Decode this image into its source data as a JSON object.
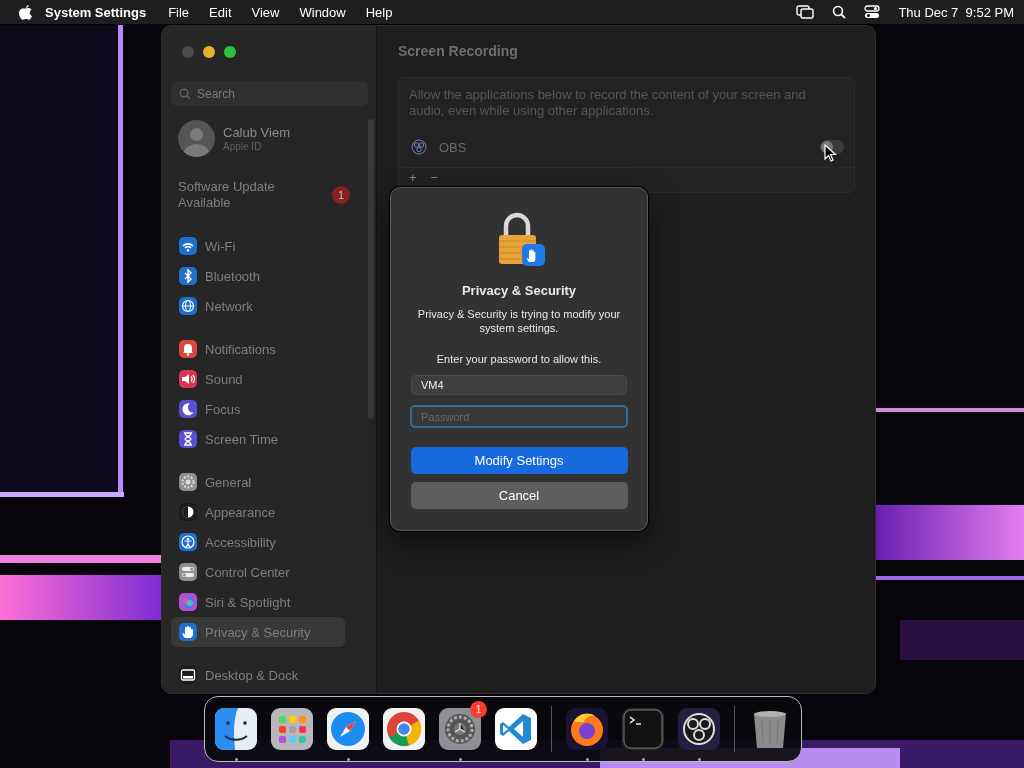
{
  "menubar": {
    "app_name": "System Settings",
    "menus": [
      "File",
      "Edit",
      "View",
      "Window",
      "Help"
    ],
    "clock": "Thu Dec 7  9:52 PM"
  },
  "sidebar": {
    "search": {
      "placeholder": "Search"
    },
    "account": {
      "name": "Calub Viem",
      "subtitle": "Apple ID"
    },
    "update": {
      "label": "Software Update Available",
      "badge": "1"
    },
    "groups": [
      [
        {
          "label": "Wi-Fi",
          "kind": "wifi",
          "color": "#1f6fd1",
          "selected": false
        },
        {
          "label": "Bluetooth",
          "kind": "bluetooth",
          "color": "#1f6fd1",
          "selected": false
        },
        {
          "label": "Network",
          "kind": "globe",
          "color": "#1f6fd1",
          "selected": false
        }
      ],
      [
        {
          "label": "Notifications",
          "kind": "bell",
          "color": "#d9453f",
          "selected": false
        },
        {
          "label": "Sound",
          "kind": "speaker",
          "color": "#d6364f",
          "selected": false
        },
        {
          "label": "Focus",
          "kind": "moon",
          "color": "#5a4fcf",
          "selected": false
        },
        {
          "label": "Screen Time",
          "kind": "hourglass",
          "color": "#5a4fcf",
          "selected": false
        }
      ],
      [
        {
          "label": "General",
          "kind": "gear",
          "color": "#8e8e93",
          "selected": false
        },
        {
          "label": "Appearance",
          "kind": "contrast",
          "color": "#1c1c1e",
          "selected": false
        },
        {
          "label": "Accessibility",
          "kind": "person",
          "color": "#1f6fd1",
          "selected": false
        },
        {
          "label": "Control Center",
          "kind": "toggles",
          "color": "#8e8e93",
          "selected": false
        },
        {
          "label": "Siri & Spotlight",
          "kind": "orb",
          "color": "#b34fd6",
          "selected": false
        },
        {
          "label": "Privacy & Security",
          "kind": "hand",
          "color": "#1f6fd1",
          "selected": true
        }
      ],
      [
        {
          "label": "Desktop & Dock",
          "kind": "dock",
          "color": "#1c1c1e",
          "selected": false
        }
      ]
    ]
  },
  "content": {
    "title": "Screen Recording",
    "description": "Allow the applications below to record the content of your screen and audio, even while using other applications.",
    "apps": [
      {
        "name": "OBS",
        "on": false
      }
    ],
    "add": "+",
    "remove": "−"
  },
  "dialog": {
    "title": "Privacy & Security",
    "message": "Privacy & Security is trying to modify your system settings.",
    "prompt": "Enter your password to allow this.",
    "username": "VM4",
    "password": {
      "placeholder": "Password"
    },
    "buttons": [
      {
        "label": "Modify Settings",
        "kind": "primary"
      },
      {
        "label": "Cancel",
        "kind": "secondary"
      }
    ]
  },
  "dock": {
    "apps": [
      {
        "kind": "finder",
        "running": true
      },
      {
        "kind": "launchpad",
        "running": false
      },
      {
        "kind": "safari",
        "running": true
      },
      {
        "kind": "chrome",
        "running": false
      },
      {
        "kind": "settings",
        "running": true,
        "badge": "1"
      },
      {
        "kind": "vscode",
        "running": false
      },
      {
        "kind": "separator"
      },
      {
        "kind": "firefox",
        "running": true
      },
      {
        "kind": "terminal",
        "running": true
      },
      {
        "kind": "obs",
        "running": true
      },
      {
        "kind": "separator"
      },
      {
        "kind": "trash",
        "running": false
      }
    ]
  }
}
